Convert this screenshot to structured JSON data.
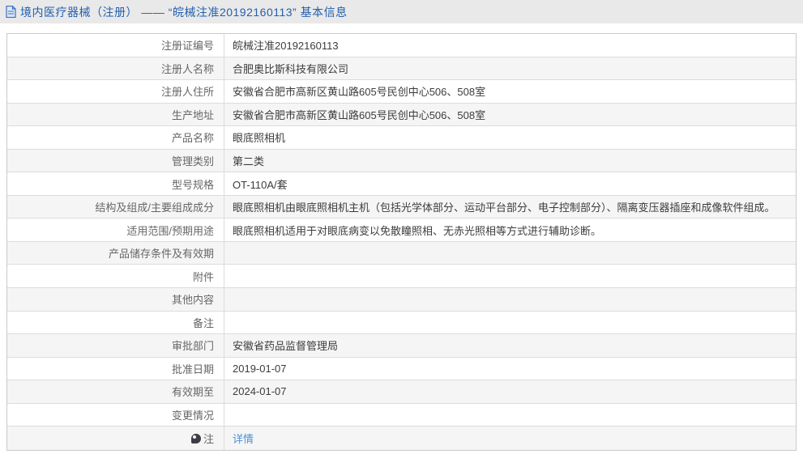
{
  "header": {
    "icon": "document-icon",
    "title": "境内医疗器械（注册） —— “皖械注准20192160113” 基本信息"
  },
  "table": {
    "rows": [
      {
        "label": "注册证编号",
        "value": "皖械注准20192160113"
      },
      {
        "label": "注册人名称",
        "value": "合肥奥比斯科技有限公司"
      },
      {
        "label": "注册人住所",
        "value": "安徽省合肥市高新区黄山路605号民创中心506、508室"
      },
      {
        "label": "生产地址",
        "value": "安徽省合肥市高新区黄山路605号民创中心506、508室"
      },
      {
        "label": "产品名称",
        "value": "眼底照相机"
      },
      {
        "label": "管理类别",
        "value": "第二类"
      },
      {
        "label": "型号规格",
        "value": "OT-110A/套"
      },
      {
        "label": "结构及组成/主要组成成分",
        "value": "眼底照相机由眼底照相机主机（包括光学体部分、运动平台部分、电子控制部分）、隔离变压器插座和成像软件组成。"
      },
      {
        "label": "适用范围/预期用途",
        "value": "眼底照相机适用于对眼底病变以免散瞳照相、无赤光照相等方式进行辅助诊断。"
      },
      {
        "label": "产品储存条件及有效期",
        "value": ""
      },
      {
        "label": "附件",
        "value": ""
      },
      {
        "label": "其他内容",
        "value": ""
      },
      {
        "label": "备注",
        "value": ""
      },
      {
        "label": "审批部门",
        "value": "安徽省药品监督管理局"
      },
      {
        "label": "批准日期",
        "value": "2019-01-07"
      },
      {
        "label": "有效期至",
        "value": "2024-01-07"
      },
      {
        "label": "变更情况",
        "value": ""
      },
      {
        "label": "注",
        "value": "详情",
        "link": true,
        "note_icon": true
      }
    ]
  },
  "colors": {
    "header_bar_bg": "#e9e9e9",
    "header_text": "#2360ae",
    "link": "#4a90da",
    "row_stripe": "#f5f5f5",
    "table_border": "#c9c9c9",
    "label_text": "#666666",
    "value_text": "#3c3c3c"
  }
}
